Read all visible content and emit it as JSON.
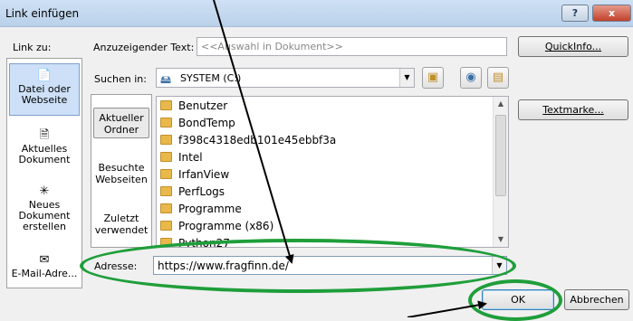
{
  "window": {
    "title": "Link einfügen",
    "help": "?",
    "close": "x"
  },
  "link_to": {
    "label": "Link zu:"
  },
  "sidebar": [
    {
      "label": "Datei oder Webseite",
      "active": true
    },
    {
      "label": "Aktuelles Dokument"
    },
    {
      "label": "Neues Dokument erstellen"
    },
    {
      "label": "E-Mail-Adre..."
    }
  ],
  "display_text": {
    "label": "Anzuzeigender Text:",
    "value": "<<Auswahl in Dokument>>"
  },
  "buttons": {
    "quickinfo": "QuickInfo...",
    "bookmark": "Textmarke...",
    "ok": "OK",
    "cancel": "Abbrechen"
  },
  "search": {
    "label": "Suchen in:",
    "value": "SYSTEM (C:)"
  },
  "lookin": [
    {
      "label": "Aktueller Ordner",
      "active": true
    },
    {
      "label": "Besuchte Webseiten"
    },
    {
      "label": "Zuletzt verwendet"
    }
  ],
  "files": [
    "Benutzer",
    "BondTemp",
    "f398c4318edb101e45ebbf3a",
    "Intel",
    "IrfanView",
    "PerfLogs",
    "Programme",
    "Programme (x86)",
    "Python27"
  ],
  "address": {
    "label": "Adresse:",
    "value": "https://www.fragfinn.de/"
  },
  "colors": {
    "highlight": "#1f9e3a",
    "arrow": "#000000"
  }
}
